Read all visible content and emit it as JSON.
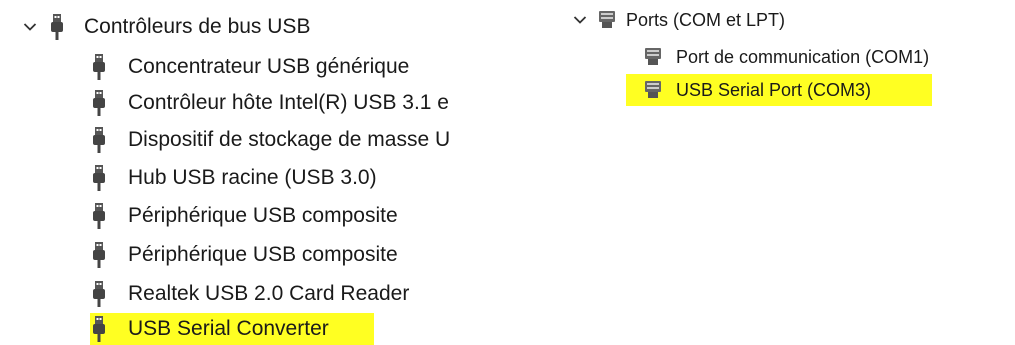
{
  "left": {
    "category": {
      "label": "Contrôleurs de bus USB",
      "icon": "usb-icon",
      "expanded": true
    },
    "items": [
      {
        "label": "Concentrateur USB générique",
        "icon": "usb-icon",
        "highlighted": false
      },
      {
        "label": "Contrôleur hôte Intel(R) USB 3.1 e",
        "icon": "usb-icon",
        "highlighted": false
      },
      {
        "label": "Dispositif de stockage de masse U",
        "icon": "usb-icon",
        "highlighted": false
      },
      {
        "label": "Hub USB racine (USB 3.0)",
        "icon": "usb-icon",
        "highlighted": false
      },
      {
        "label": "Périphérique USB composite",
        "icon": "usb-icon",
        "highlighted": false
      },
      {
        "label": "Périphérique USB composite",
        "icon": "usb-icon",
        "highlighted": false
      },
      {
        "label": "Realtek USB 2.0 Card Reader",
        "icon": "usb-icon",
        "highlighted": false
      },
      {
        "label": "USB Serial Converter",
        "icon": "usb-icon",
        "highlighted": true
      }
    ]
  },
  "right": {
    "category": {
      "label": "Ports (COM et LPT)",
      "icon": "port-icon",
      "expanded": true
    },
    "items": [
      {
        "label": "Port de communication (COM1)",
        "icon": "port-icon",
        "highlighted": false
      },
      {
        "label": "USB Serial Port (COM3)",
        "icon": "port-icon",
        "highlighted": true
      }
    ]
  },
  "colors": {
    "highlight": "#ffff22",
    "icon": "#4a4a4a",
    "text": "#1a1a1a"
  }
}
